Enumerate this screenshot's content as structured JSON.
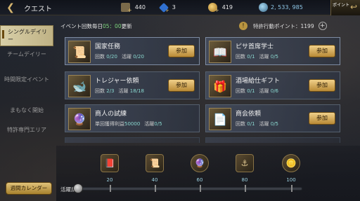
{
  "header": {
    "title": "クエスト",
    "resources": [
      {
        "name": "cards",
        "value": "440",
        "icon": "card-icon"
      },
      {
        "name": "gems",
        "value": "3",
        "icon": "gem-icon"
      },
      {
        "name": "gold",
        "value": "419",
        "icon": "coin-icon"
      },
      {
        "name": "silver",
        "value": "2, 533, 985",
        "icon": "silver-coin-icon"
      }
    ],
    "corner_label": "ポイント"
  },
  "sidebar": {
    "items": [
      {
        "label": "シングルデイリー",
        "active": true
      },
      {
        "label": "チームデイリー",
        "active": false
      },
      {
        "label": "時間限定イベント",
        "active": false
      },
      {
        "label": "まもなく開始",
        "active": false
      },
      {
        "label": "特許専門エリア",
        "active": false
      }
    ],
    "calendar_button": "週間カレンダー"
  },
  "event": {
    "prefix": "イベント回数毎日",
    "time": "05：00",
    "suffix": "更新",
    "special_points_label": "特許行動ポイント：1199"
  },
  "quests": [
    {
      "name": "国家任務",
      "stat1_label": "回数",
      "stat1_value": "0/20",
      "stat2_label": "活躍",
      "stat2_value": "0/20",
      "button": "参加",
      "icon": "scroll-icon"
    },
    {
      "name": "ピサ首席学士",
      "stat1_label": "回数",
      "stat1_value": "0/1",
      "stat2_label": "活躍",
      "stat2_value": "0/5",
      "button": "参加",
      "icon": "book-icon"
    },
    {
      "name": "トレジャー依頼",
      "stat1_label": "回数",
      "stat1_value": "2/3",
      "stat2_label": "活躍",
      "stat2_value": "18/18",
      "button": "参加",
      "icon": "treasure-icon"
    },
    {
      "name": "酒場給仕ギフト",
      "stat1_label": "回数",
      "stat1_value": "0/1",
      "stat2_label": "活躍",
      "stat2_value": "0/6",
      "button": "参加",
      "icon": "gift-icon"
    },
    {
      "name": "商人の試練",
      "stat1_label": "単回獲得利益",
      "stat1_value": "50000",
      "stat2_label": "活躍",
      "stat2_value": "0/5",
      "button": "",
      "icon": "crystal-ball-icon"
    },
    {
      "name": "商会依頼",
      "stat1_label": "回数",
      "stat1_value": "0/1",
      "stat2_label": "活躍",
      "stat2_value": "0/5",
      "button": "参加",
      "icon": "document-icon"
    }
  ],
  "activity": {
    "label": "活躍度",
    "progress_percent": 3,
    "milestones": [
      "20",
      "40",
      "60",
      "80",
      "100"
    ]
  }
}
